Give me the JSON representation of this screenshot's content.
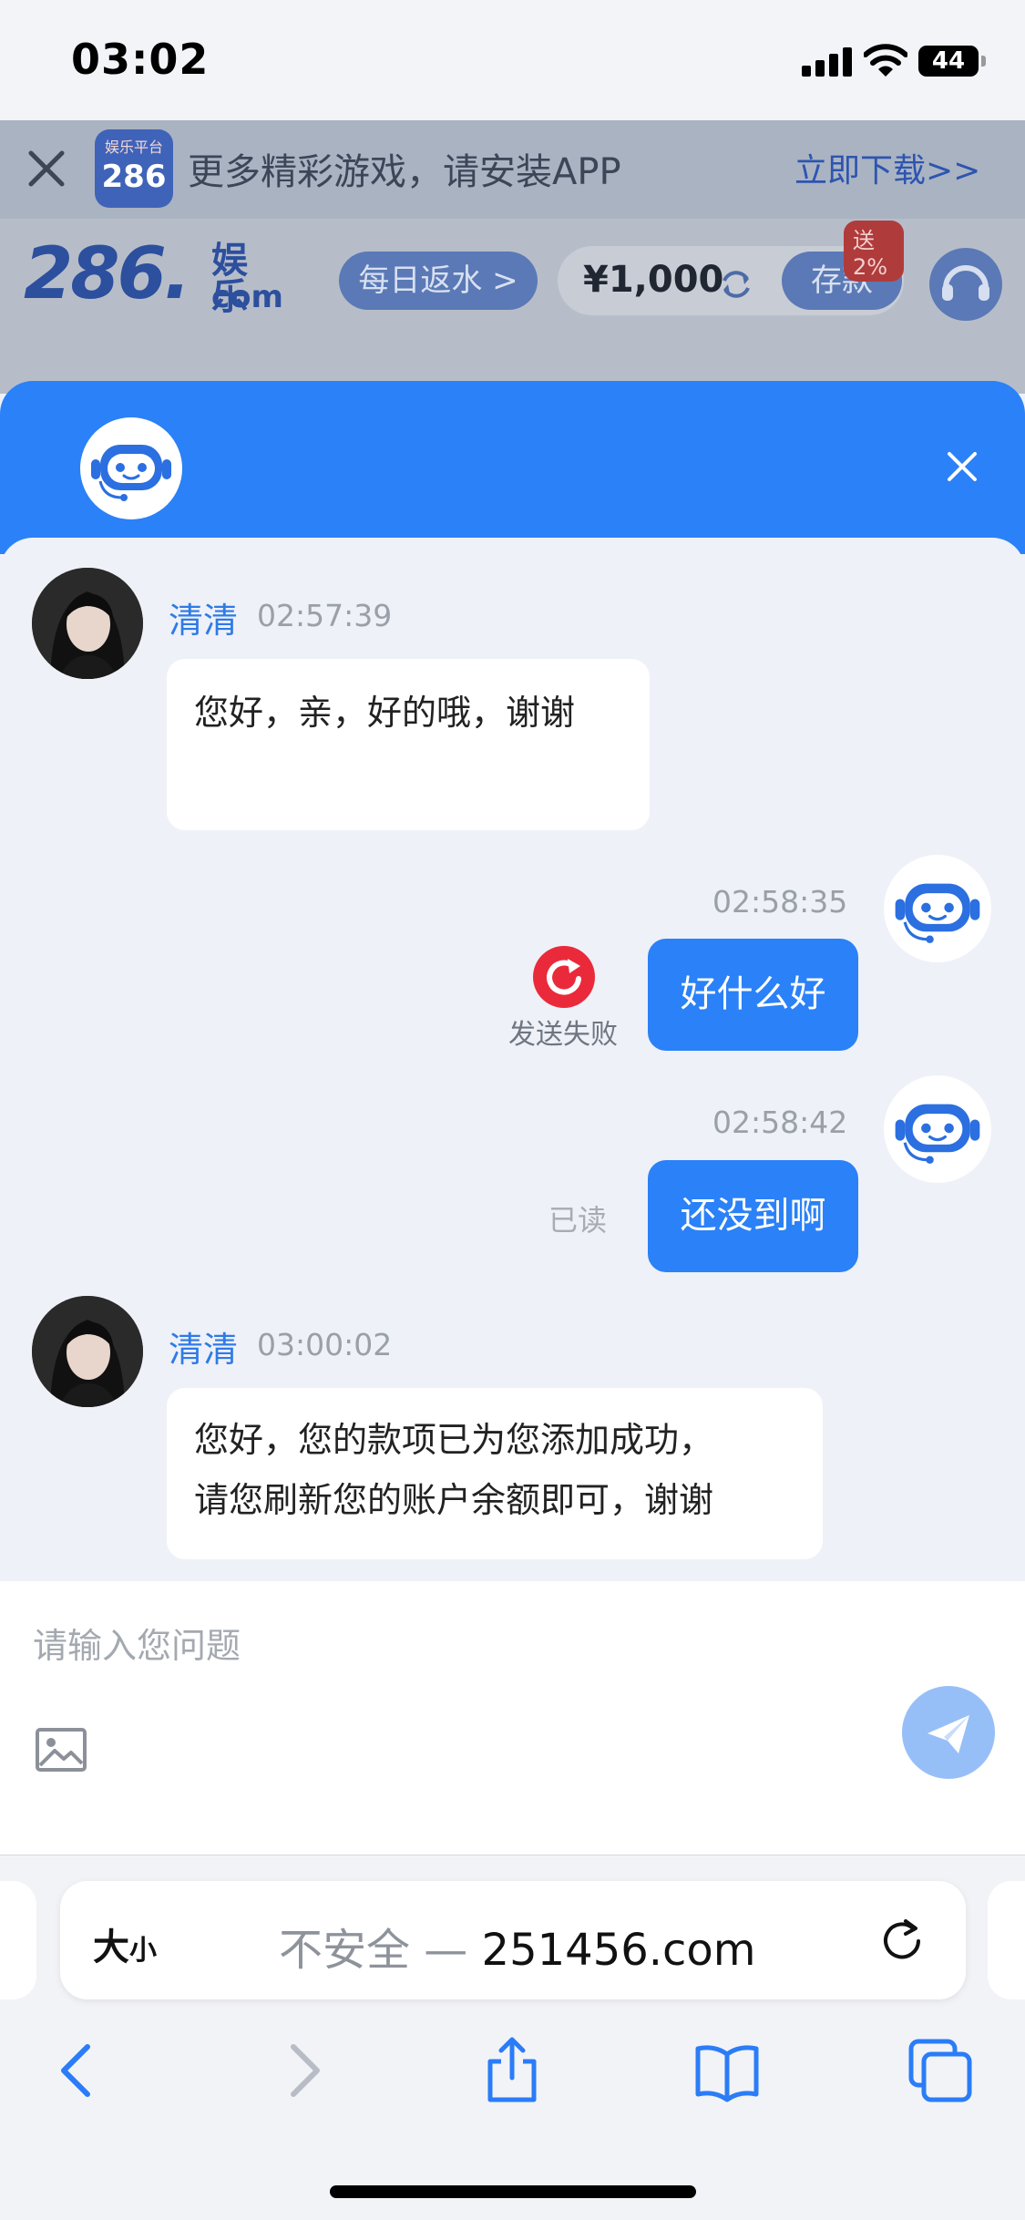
{
  "status_bar": {
    "time": "03:02",
    "battery": "44"
  },
  "banner": {
    "app_icon_tag": "娱乐平台",
    "app_icon_number": "286",
    "text": "更多精彩游戏，请安装APP",
    "download_link": "立即下载>>"
  },
  "site_header": {
    "logo_number": "286.",
    "logo_name": "娱乐",
    "logo_suffix": "com",
    "rebate_button": "每日返水 >",
    "balance": "¥1,000",
    "deposit_button": "存款",
    "deposit_badge": "送2%"
  },
  "chat": {
    "messages": [
      {
        "direction": "in",
        "sender": "清清",
        "time": "02:57:39",
        "text": "您好，亲，好的哦，谢谢"
      },
      {
        "direction": "out",
        "time": "02:58:35",
        "text": "好什么好",
        "status": "发送失败"
      },
      {
        "direction": "out",
        "time": "02:58:42",
        "text": "还没到啊",
        "status": "已读"
      },
      {
        "direction": "in",
        "sender": "清清",
        "time": "03:00:02",
        "text_lines": [
          "您好，您的款项已为您添加成功，",
          "请您刷新您的账户余额即可，谢谢"
        ]
      }
    ],
    "input_placeholder": "请输入您问题"
  },
  "browser": {
    "text_size_label_big": "大",
    "text_size_label_small": "小",
    "url_security": "不安全 — ",
    "url_domain": "251456.com"
  },
  "colors": {
    "accent": "#2b81f7",
    "agent_name": "#2f7ae6",
    "fail_red": "#ea2a3a",
    "send_button": "#97bff7"
  }
}
